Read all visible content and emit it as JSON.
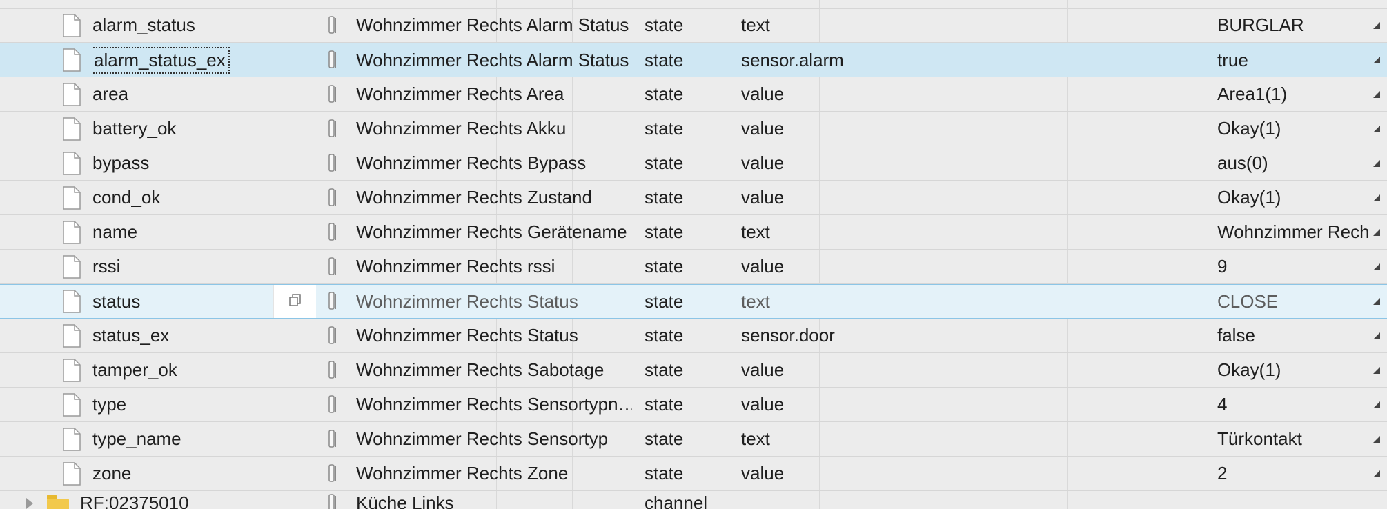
{
  "rows": [
    {
      "id": "alarm_status",
      "name": "Wohnzimmer Rechts Alarm Status",
      "type": "state",
      "role": "text",
      "value": "BURGLAR"
    },
    {
      "id": "alarm_status_ex",
      "name": "Wohnzimmer Rechts Alarm Status",
      "type": "state",
      "role": "sensor.alarm",
      "value": "true"
    },
    {
      "id": "area",
      "name": "Wohnzimmer Rechts Area",
      "type": "state",
      "role": "value",
      "value": "Area1(1)"
    },
    {
      "id": "battery_ok",
      "name": "Wohnzimmer Rechts Akku",
      "type": "state",
      "role": "value",
      "value": "Okay(1)"
    },
    {
      "id": "bypass",
      "name": "Wohnzimmer Rechts Bypass",
      "type": "state",
      "role": "value",
      "value": "aus(0)"
    },
    {
      "id": "cond_ok",
      "name": "Wohnzimmer Rechts Zustand",
      "type": "state",
      "role": "value",
      "value": "Okay(1)"
    },
    {
      "id": "name",
      "name": "Wohnzimmer Rechts Gerätename",
      "type": "state",
      "role": "text",
      "value": "Wohnzimmer Recht"
    },
    {
      "id": "rssi",
      "name": "Wohnzimmer Rechts rssi",
      "type": "state",
      "role": "value",
      "value": "9"
    },
    {
      "id": "status",
      "name": "Wohnzimmer Rechts Status",
      "type": "state",
      "role": "text",
      "value": "CLOSE"
    },
    {
      "id": "status_ex",
      "name": "Wohnzimmer Rechts Status",
      "type": "state",
      "role": "sensor.door",
      "value": "false"
    },
    {
      "id": "tamper_ok",
      "name": "Wohnzimmer Rechts Sabotage",
      "type": "state",
      "role": "value",
      "value": "Okay(1)"
    },
    {
      "id": "type",
      "name": "Wohnzimmer Rechts Sensortypn…",
      "type": "state",
      "role": "value",
      "value": "4"
    },
    {
      "id": "type_name",
      "name": "Wohnzimmer Rechts Sensortyp",
      "type": "state",
      "role": "text",
      "value": "Türkontakt"
    },
    {
      "id": "zone",
      "name": "Wohnzimmer Rechts Zone",
      "type": "state",
      "role": "value",
      "value": "2"
    }
  ],
  "folder_row": {
    "id": "RF:02375010",
    "name": "Küche Links",
    "type": "channel"
  },
  "colors": {
    "background": "#ececec",
    "selected_row": "#cfe7f3",
    "hover_row": "#e4f2f9",
    "accent_border": "#4ea6d8",
    "folder": "#f2c94c"
  },
  "icons": {
    "row_icon": "file-icon",
    "copy": "copy-icon",
    "indicator": "device-indicator-icon",
    "folder": "folder-icon",
    "edit": "edit-icon"
  },
  "state": {
    "selected_row_id": "alarm_status_ex",
    "hover_row_id": "status"
  }
}
